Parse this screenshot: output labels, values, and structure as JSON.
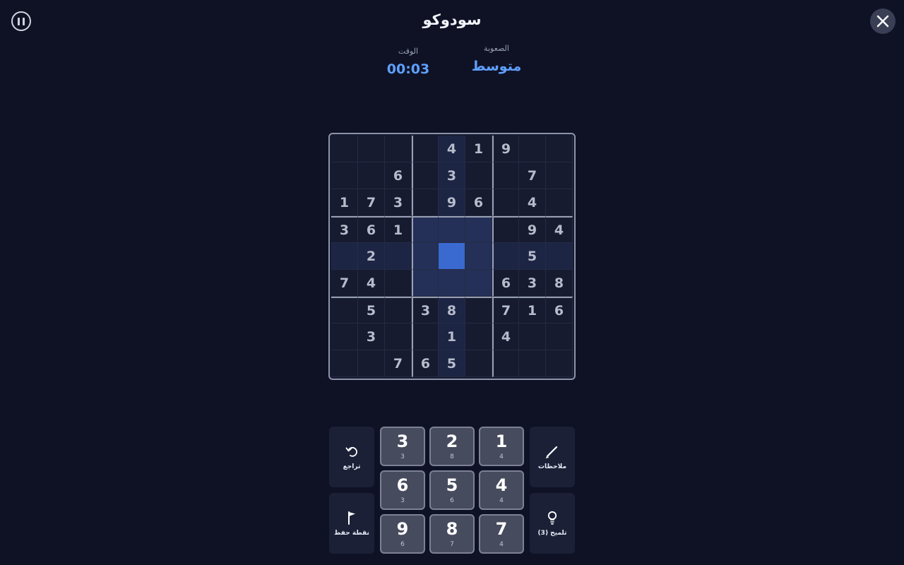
{
  "header": {
    "title": "سودوكو",
    "pause_icon": "pause-circle-icon",
    "close_icon": "close-icon"
  },
  "stats": {
    "time_label": "الوقت",
    "time_value": "00:03",
    "difficulty_label": "الصعوبة",
    "difficulty_value": "متوسط"
  },
  "board": {
    "cells": [
      [
        "",
        "",
        "",
        "",
        "4",
        "1",
        "9",
        "",
        ""
      ],
      [
        "",
        "",
        "6",
        "",
        "3",
        "",
        "",
        "7",
        ""
      ],
      [
        "1",
        "7",
        "3",
        "",
        "9",
        "6",
        "",
        "4",
        ""
      ],
      [
        "3",
        "6",
        "1",
        "",
        "",
        "",
        "",
        "9",
        "4"
      ],
      [
        "",
        "2",
        "",
        "",
        "",
        "",
        "",
        "5",
        ""
      ],
      [
        "7",
        "4",
        "",
        "",
        "",
        "",
        "6",
        "3",
        "8"
      ],
      [
        "",
        "5",
        "",
        "3",
        "8",
        "",
        "7",
        "1",
        "6"
      ],
      [
        "",
        "3",
        "",
        "",
        "1",
        "",
        "4",
        "",
        ""
      ],
      [
        "",
        "",
        "7",
        "6",
        "5",
        "",
        "",
        "",
        ""
      ]
    ],
    "selected": {
      "row": 5,
      "col": 5
    }
  },
  "actions": {
    "undo_label": "تراجع",
    "notes_label": "ملاحظات",
    "checkpoint_label": "نقطة حفظ",
    "hint_label": "تلميح (3)"
  },
  "numpad": [
    {
      "digit": "3",
      "count": "3"
    },
    {
      "digit": "2",
      "count": "8"
    },
    {
      "digit": "1",
      "count": "4"
    },
    {
      "digit": "6",
      "count": "3"
    },
    {
      "digit": "5",
      "count": "6"
    },
    {
      "digit": "4",
      "count": "4"
    },
    {
      "digit": "9",
      "count": "6"
    },
    {
      "digit": "8",
      "count": "7"
    },
    {
      "digit": "7",
      "count": "4"
    }
  ],
  "colors": {
    "background": "#0f1225",
    "accent": "#5fa0ff",
    "selected_cell": "#3a6ad0"
  }
}
